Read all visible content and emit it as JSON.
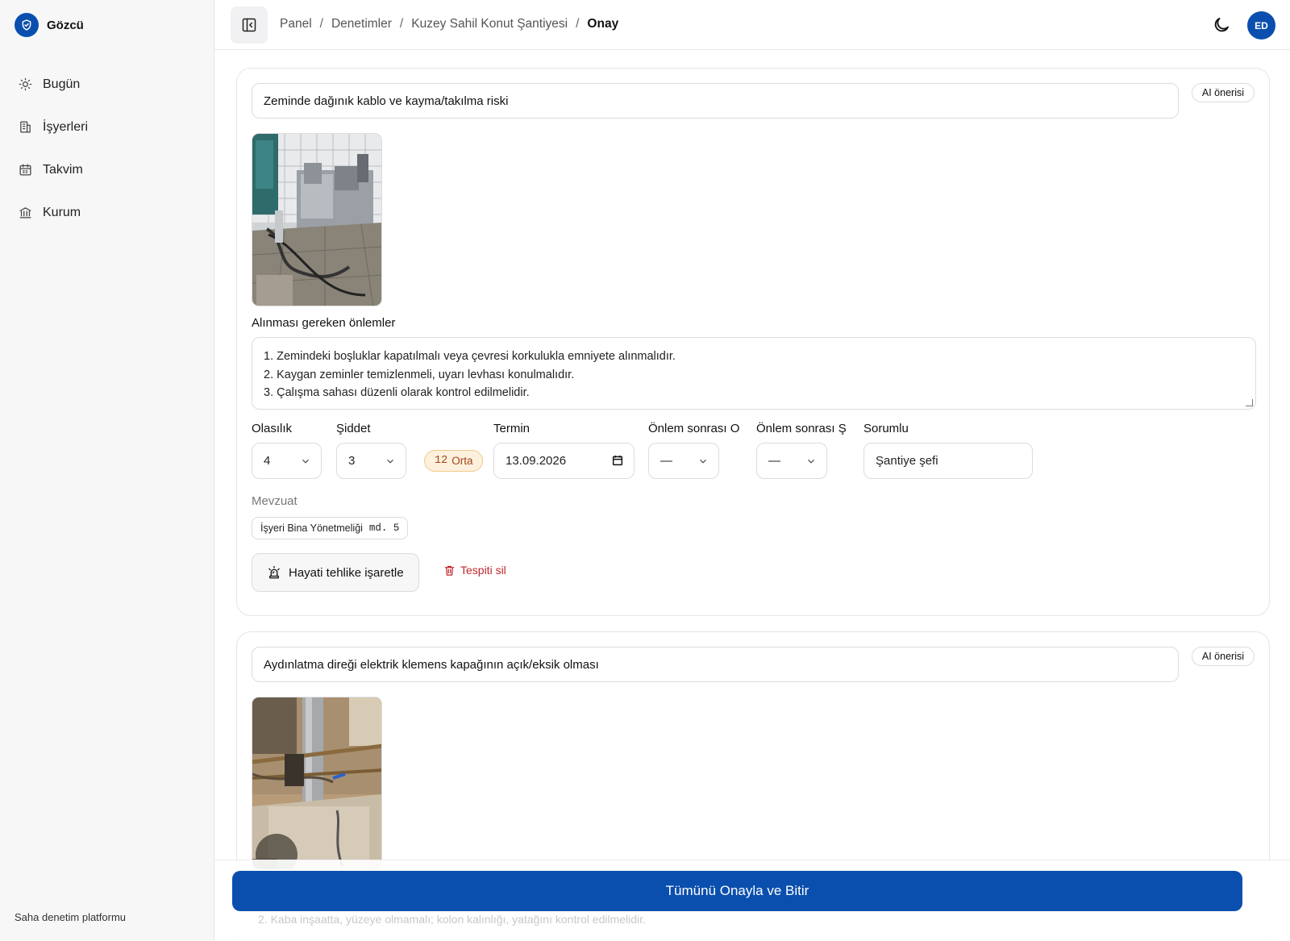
{
  "brand": {
    "name": "Gözcü",
    "icon": "shield-check-icon",
    "color": "#0b4fae"
  },
  "sidebar": {
    "items": [
      {
        "label": "Bugün",
        "icon": "sun-icon"
      },
      {
        "label": "İşyerleri",
        "icon": "building-icon"
      },
      {
        "label": "Takvim",
        "icon": "calendar-icon"
      },
      {
        "label": "Kurum",
        "icon": "institution-icon"
      }
    ],
    "footer": "Saha denetim platformu"
  },
  "header": {
    "breadcrumb": [
      "Panel",
      "Denetimler",
      "Kuzey Sahil Konut Şantiyesi",
      "Onay"
    ],
    "avatar": "ED"
  },
  "findings": [
    {
      "title": "Zeminde dağınık kablo ve kayma/takılma riski",
      "ai_label": "AI önerisi",
      "measures_label": "Alınması gereken önlemler",
      "measures": [
        "1. Zemindeki boşluklar kapatılmalı veya çevresi korkulukla emniyete alınmalıdır.",
        "2. Kaygan zeminler temizlenmeli, uyarı levhası konulmalıdır.",
        "3. Çalışma sahası düzenli olarak kontrol edilmelidir."
      ],
      "fields": {
        "olasilik_label": "Olasılık",
        "olasilik": "4",
        "siddet_label": "Şiddet",
        "siddet": "3",
        "risk_score": "12",
        "risk_level": "Orta",
        "termin_label": "Termin",
        "termin": "13.09.2026",
        "onlem_o_label": "Önlem sonrası O",
        "onlem_o": "—",
        "onlem_s_label": "Önlem sonrası Ş",
        "onlem_s": "—",
        "sorumlu_label": "Sorumlu",
        "sorumlu": "Şantiye şefi"
      },
      "mevzuat_label": "Mevzuat",
      "mevzuat": {
        "name": "İşyeri Bina Yönetmeliği",
        "article": "md. 5"
      },
      "danger_label": "Hayati tehlike işaretle",
      "delete_label": "Tespiti sil"
    },
    {
      "title": "Aydınlatma direği elektrik klemens kapağının açık/eksik olması",
      "ai_label": "AI önerisi"
    }
  ],
  "footer": {
    "confirm_label": "Tümünü Onayla ve Bitir",
    "ghost_text": "2. Kaba inşaatta, yüzeye olmamalı; kolon kalınlığı, yatağını kontrol edilmelidir."
  },
  "colors": {
    "primary": "#0b4fae",
    "danger": "#c0272d",
    "badge_bg": "#fdf1dd",
    "badge_text": "#a4431a"
  }
}
